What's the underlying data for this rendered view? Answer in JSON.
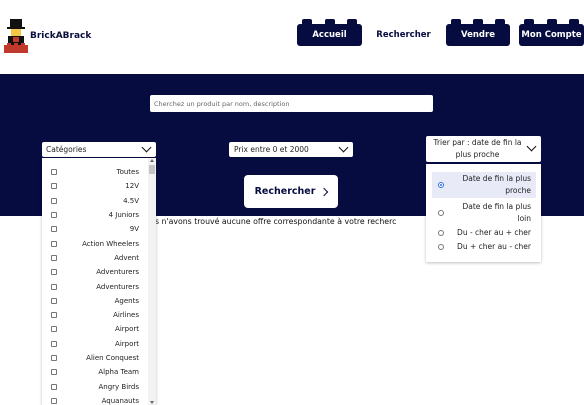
{
  "brand": {
    "name": "BrickABrack"
  },
  "nav": {
    "home": "Accueil",
    "search": "Rechercher",
    "sell": "Vendre",
    "account": "Mon Compte"
  },
  "search": {
    "placeholder": "Cherchez un produit par nom, description",
    "button_label": "Rechercher"
  },
  "filters": {
    "categories_label": "Catégories",
    "price_label": "Prix entre 0 et 2000",
    "sort_label": "Trier par : date de fin la plus proche"
  },
  "categories": [
    "Toutes",
    "12V",
    "4.5V",
    "4 Juniors",
    "9V",
    "Action Wheelers",
    "Advent",
    "Adventurers",
    "Adventurers",
    "Agents",
    "Airlines",
    "Airport",
    "Airport",
    "Alien Conquest",
    "Alpha Team",
    "Angry Birds",
    "Aquanauts"
  ],
  "sort_options": [
    {
      "label": "Date de fin la plus proche",
      "selected": true
    },
    {
      "label": "Date de fin la plus loin",
      "selected": false
    },
    {
      "label": "Du - cher au + cher",
      "selected": false
    },
    {
      "label": "Du + cher au - cher",
      "selected": false
    }
  ],
  "message": {
    "no_results": "us n'avons trouvé aucune offre correspondante à votre recherc"
  },
  "colors": {
    "navy": "#060b40",
    "white": "#ffffff",
    "accent": "#2d6fe0"
  }
}
